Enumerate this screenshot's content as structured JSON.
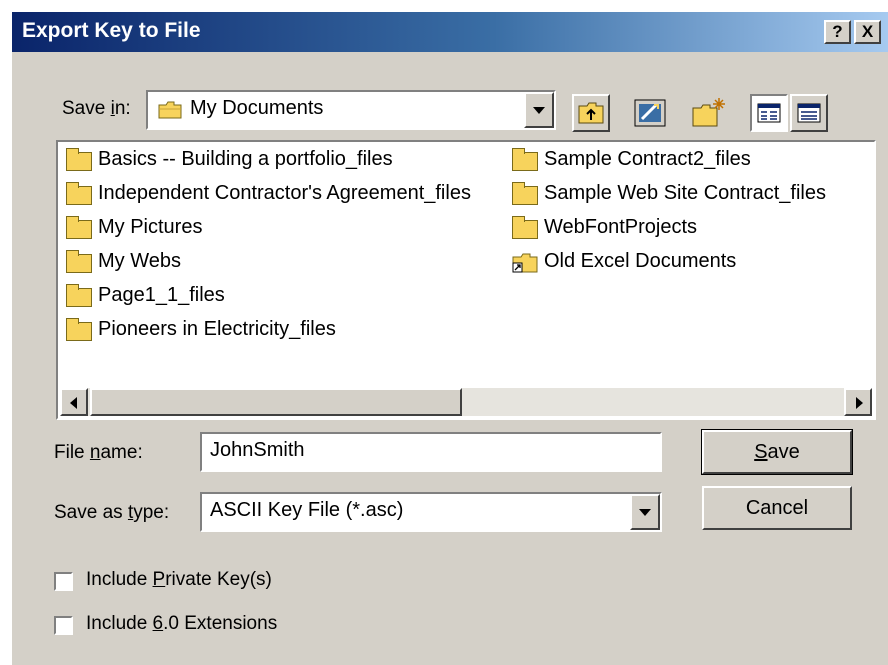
{
  "window": {
    "title": "Export Key to File",
    "help_btn": "?",
    "close_btn": "X"
  },
  "save_in": {
    "label": "Save in:",
    "value": "My Documents"
  },
  "toolbar": [
    "up-one-level-icon",
    "desktop-icon",
    "new-folder-icon",
    "list-view-icon",
    "details-view-icon"
  ],
  "files": {
    "left": [
      "Basics -- Building a portfolio_files",
      "Independent Contractor's Agreement_files",
      "My Pictures",
      "My Webs",
      "Page1_1_files",
      "Pioneers in Electricity_files"
    ],
    "right": [
      "Sample Contract2_files",
      "Sample Web Site Contract_files",
      "WebFontProjects",
      "Old Excel Documents"
    ]
  },
  "file_name": {
    "label": "File name:",
    "value": "JohnSmith"
  },
  "save_as_type": {
    "label": "Save as type:",
    "value": "ASCII Key File (*.asc)"
  },
  "buttons": {
    "save": "Save",
    "cancel": "Cancel"
  },
  "options": [
    {
      "label": "Include Private Key(s)",
      "checked": false
    },
    {
      "label": "Include 6.0 Extensions",
      "checked": false
    }
  ]
}
